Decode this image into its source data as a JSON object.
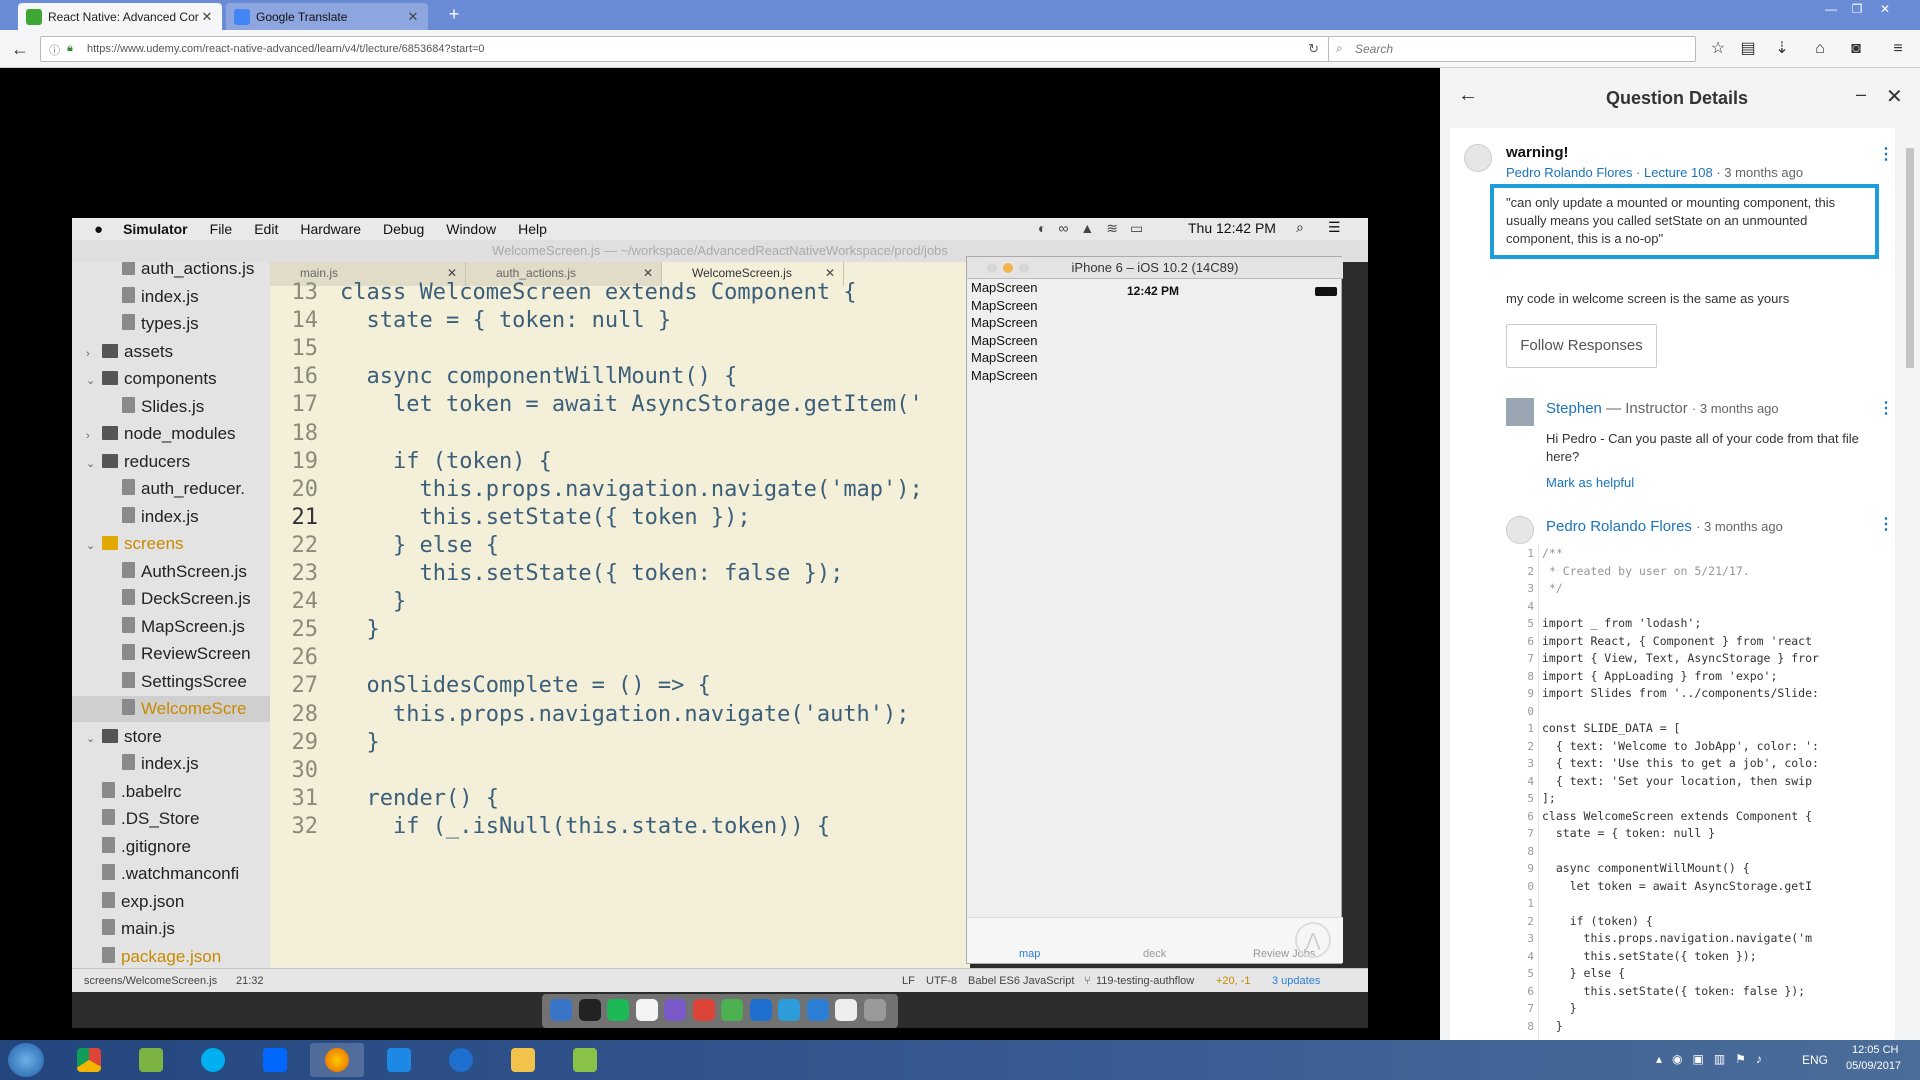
{
  "browser": {
    "tabs": [
      {
        "label": "React Native: Advanced Cor",
        "active": true
      },
      {
        "label": "Google Translate",
        "active": false
      }
    ],
    "new_tab": "+",
    "url": "https://www.udemy.com/react-native-advanced/learn/v4/t/lecture/6853684?start=0",
    "search_placeholder": "Search"
  },
  "mac": {
    "menu": [
      "Simulator",
      "File",
      "Edit",
      "Hardware",
      "Debug",
      "Window",
      "Help"
    ],
    "clock": "Thu 12:42 PM",
    "window_title": "WelcomeScreen.js — ~/workspace/AdvancedReactNativeWorkspace/prod/jobs"
  },
  "tree": [
    {
      "label": "auth_actions.js",
      "type": "file",
      "indent": 2
    },
    {
      "label": "index.js",
      "type": "file",
      "indent": 2
    },
    {
      "label": "types.js",
      "type": "file",
      "indent": 2
    },
    {
      "label": "assets",
      "type": "folder",
      "indent": 1
    },
    {
      "label": "components",
      "type": "folder-open",
      "indent": 1
    },
    {
      "label": "Slides.js",
      "type": "file",
      "indent": 2
    },
    {
      "label": "node_modules",
      "type": "folder",
      "indent": 1
    },
    {
      "label": "reducers",
      "type": "folder-open",
      "indent": 1
    },
    {
      "label": "auth_reducer.",
      "type": "file",
      "indent": 2
    },
    {
      "label": "index.js",
      "type": "file",
      "indent": 2
    },
    {
      "label": "screens",
      "type": "folder-open",
      "indent": 1,
      "highlight": true
    },
    {
      "label": "AuthScreen.js",
      "type": "file",
      "indent": 2
    },
    {
      "label": "DeckScreen.js",
      "type": "file",
      "indent": 2
    },
    {
      "label": "MapScreen.js",
      "type": "file",
      "indent": 2
    },
    {
      "label": "ReviewScreen",
      "type": "file",
      "indent": 2
    },
    {
      "label": "SettingsScree",
      "type": "file",
      "indent": 2
    },
    {
      "label": "WelcomeScre",
      "type": "file",
      "indent": 2,
      "selected": true
    },
    {
      "label": "store",
      "type": "folder-open",
      "indent": 1
    },
    {
      "label": "index.js",
      "type": "file",
      "indent": 2
    },
    {
      "label": ".babelrc",
      "type": "file",
      "indent": 1
    },
    {
      "label": ".DS_Store",
      "type": "file",
      "indent": 1
    },
    {
      "label": ".gitignore",
      "type": "file",
      "indent": 1
    },
    {
      "label": ".watchmanconfi",
      "type": "file",
      "indent": 1
    },
    {
      "label": "exp.json",
      "type": "file",
      "indent": 1
    },
    {
      "label": "main.js",
      "type": "file",
      "indent": 1
    },
    {
      "label": "package.json",
      "type": "file",
      "indent": 1,
      "highlight": true
    }
  ],
  "editor_tabs": [
    "main.js",
    "auth_actions.js",
    "WelcomeScreen.js"
  ],
  "editor_lines": [
    {
      "n": "13",
      "t": "class WelcomeScreen extends Component {"
    },
    {
      "n": "14",
      "t": "  state = { token: null }"
    },
    {
      "n": "15",
      "t": ""
    },
    {
      "n": "16",
      "t": "  async componentWillMount() {"
    },
    {
      "n": "17",
      "t": "    let token = await AsyncStorage.getItem('"
    },
    {
      "n": "18",
      "t": ""
    },
    {
      "n": "19",
      "t": "    if (token) {"
    },
    {
      "n": "20",
      "t": "      this.props.navigation.navigate('map');"
    },
    {
      "n": "21",
      "t": "      this.setState({ token });"
    },
    {
      "n": "22",
      "t": "    } else {"
    },
    {
      "n": "23",
      "t": "      this.setState({ token: false });"
    },
    {
      "n": "24",
      "t": "    }"
    },
    {
      "n": "25",
      "t": "  }"
    },
    {
      "n": "26",
      "t": ""
    },
    {
      "n": "27",
      "t": "  onSlidesComplete = () => {"
    },
    {
      "n": "28",
      "t": "    this.props.navigation.navigate('auth');"
    },
    {
      "n": "29",
      "t": "  }"
    },
    {
      "n": "30",
      "t": ""
    },
    {
      "n": "31",
      "t": "  render() {"
    },
    {
      "n": "32",
      "t": "    if (_.isNull(this.state.token)) {"
    }
  ],
  "simulator": {
    "title": "iPhone 6 – iOS 10.2 (14C89)",
    "time": "12:42 PM",
    "rows": [
      "MapScreen",
      "MapScreen",
      "MapScreen",
      "MapScreen",
      "MapScreen",
      "MapScreen"
    ],
    "tabs": [
      "map",
      "deck",
      "Review Jobs"
    ]
  },
  "statusbar": {
    "path": "screens/WelcomeScreen.js",
    "pos": "21:32",
    "items": [
      "LF",
      "UTF-8",
      "Babel ES6 JavaScript",
      "119-testing-authflow",
      "+20, -1",
      "3 updates"
    ]
  },
  "panel": {
    "title": "Question Details",
    "question": {
      "title": "warning!",
      "author": "Pedro Rolando Flores",
      "lecture": "Lecture 108",
      "time": "3 months ago",
      "quote": "\"can only update a mounted or mounting component, this usually means you called setState on an unmounted component, this is a no-op\"",
      "body": "my code in welcome screen is the same as yours"
    },
    "follow_label": "Follow Responses",
    "reply1": {
      "author": "Stephen",
      "role": "— Instructor",
      "time": "· 3 months ago",
      "text": "Hi Pedro - Can you paste all of your code from that file here?",
      "helpful": "Mark as helpful"
    },
    "reply2": {
      "author": "Pedro Rolando Flores",
      "time": "· 3 months ago"
    },
    "code_lines": [
      {
        "n": "1",
        "t": "/**"
      },
      {
        "n": "2",
        "t": " * Created by user on 5/21/17."
      },
      {
        "n": "3",
        "t": " */"
      },
      {
        "n": "4",
        "t": ""
      },
      {
        "n": "5",
        "t": "import _ from 'lodash';"
      },
      {
        "n": "6",
        "t": "import React, { Component } from 'react"
      },
      {
        "n": "7",
        "t": "import { View, Text, AsyncStorage } fror"
      },
      {
        "n": "8",
        "t": "import { AppLoading } from 'expo';"
      },
      {
        "n": "9",
        "t": "import Slides from '../components/Slide:"
      },
      {
        "n": "0",
        "t": ""
      },
      {
        "n": "1",
        "t": "const SLIDE_DATA = ["
      },
      {
        "n": "2",
        "t": "  { text: 'Welcome to JobApp', color: ':"
      },
      {
        "n": "3",
        "t": "  { text: 'Use this to get a job', colo:"
      },
      {
        "n": "4",
        "t": "  { text: 'Set your location, then swip"
      },
      {
        "n": "5",
        "t": "];"
      },
      {
        "n": "6",
        "t": "class WelcomeScreen extends Component {"
      },
      {
        "n": "7",
        "t": "  state = { token: null }"
      },
      {
        "n": "8",
        "t": ""
      },
      {
        "n": "9",
        "t": "  async componentWillMount() {"
      },
      {
        "n": "0",
        "t": "    let token = await AsyncStorage.getI"
      },
      {
        "n": "1",
        "t": ""
      },
      {
        "n": "2",
        "t": "    if (token) {"
      },
      {
        "n": "3",
        "t": "      this.props.navigation.navigate('m"
      },
      {
        "n": "4",
        "t": "      this.setState({ token });"
      },
      {
        "n": "5",
        "t": "    } else {"
      },
      {
        "n": "6",
        "t": "      this.setState({ token: false });"
      },
      {
        "n": "7",
        "t": "    }"
      },
      {
        "n": "8",
        "t": "  }"
      }
    ]
  },
  "taskbar": {
    "lang": "ENG",
    "time": "12:05 CH",
    "date": "05/09/2017"
  }
}
